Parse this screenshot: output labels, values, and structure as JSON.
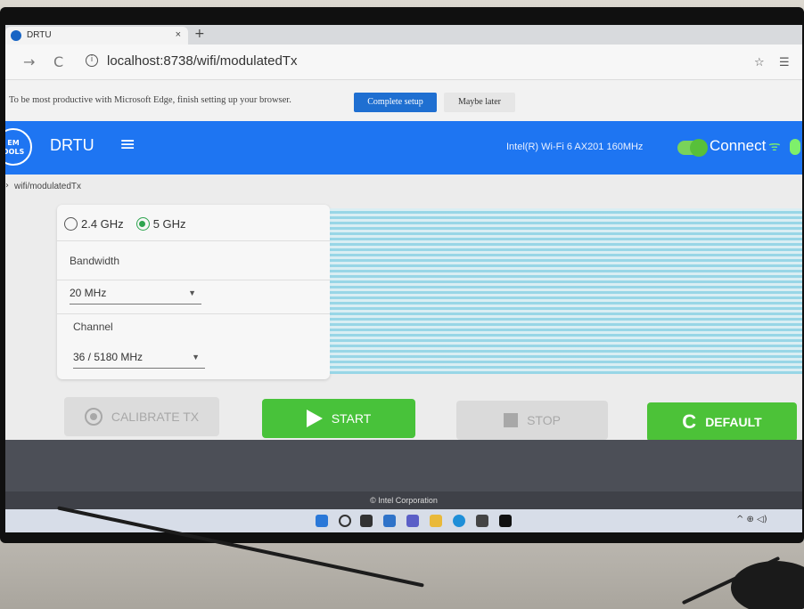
{
  "browser": {
    "tab_title": "DRTU",
    "tab_close": "×",
    "new_tab": "+",
    "url": "localhost:8738/wifi/modulatedTx",
    "back": "→",
    "reload": "C",
    "info": "i"
  },
  "infobar": {
    "message": "To be most productive with Microsoft Edge, finish setting up your browser.",
    "complete_label": "Complete setup",
    "later_label": "Maybe later"
  },
  "header": {
    "logo_text": "EM OOLS",
    "title": "DRTU",
    "menu_glyph": "≡",
    "adapter": "Intel(R) Wi-Fi 6 AX201 160MHz",
    "connect_label": "Connect",
    "wifi_glyph": "ᯤ"
  },
  "breadcrumb": "wifi/modulatedTx",
  "settings": {
    "band_options": [
      "2.4 GHz",
      "5 GHz"
    ],
    "band_selected": "5 GHz",
    "bandwidth_label": "Bandwidth",
    "bandwidth_value": "20 MHz",
    "channel_label": "Channel",
    "channel_value": "36 / 5180 MHz",
    "caret": "▼"
  },
  "actions": {
    "calibrate_label": "CALIBRATE TX",
    "start_label": "START",
    "stop_label": "STOP",
    "default_label": "DEFAULT",
    "refresh_glyph": "C"
  },
  "footer": "© Intel Corporation"
}
